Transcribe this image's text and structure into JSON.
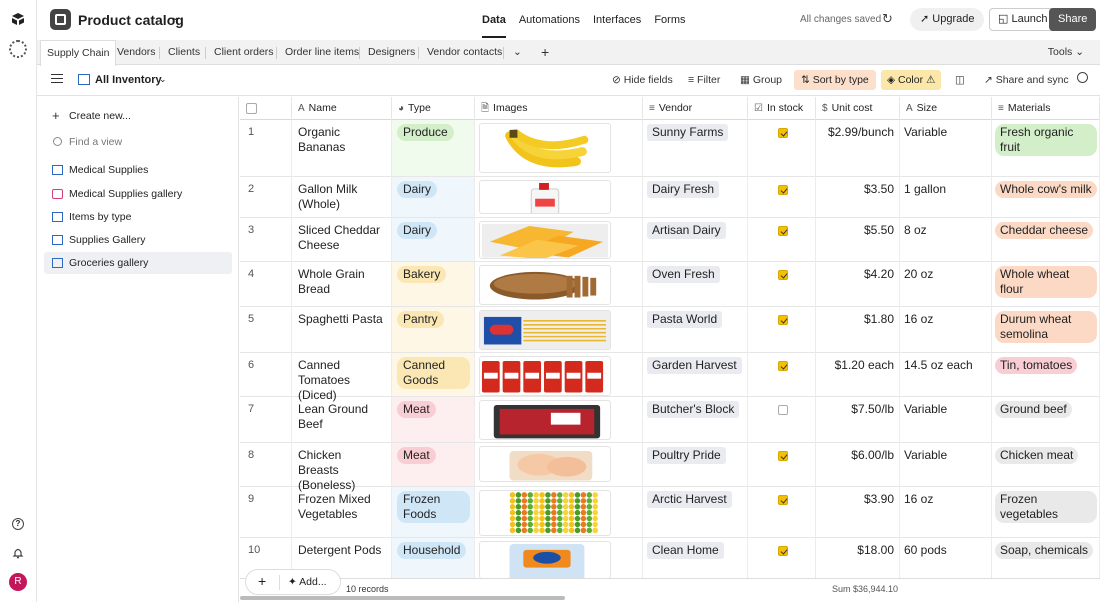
{
  "topbar": {
    "base_title": "Product catalog",
    "nav": [
      "Data",
      "Automations",
      "Interfaces",
      "Forms"
    ],
    "saved_status": "All changes saved",
    "upgrade_label": "Upgrade",
    "launch_label": "Launch",
    "share_label": "Share"
  },
  "tabs": {
    "items": [
      "Supply Chain",
      "Vendors",
      "Clients",
      "Client orders",
      "Order line items",
      "Designers",
      "Vendor contacts"
    ],
    "tools_label": "Tools"
  },
  "viewbar": {
    "view_name": "All Inventory",
    "hide_fields": "Hide fields",
    "filter": "Filter",
    "group": "Group",
    "sort": "Sort by type",
    "color": "Color",
    "share_sync": "Share and sync"
  },
  "sidebar": {
    "create_new": "Create new...",
    "find_view": "Find a view",
    "views": [
      {
        "label": "Medical Supplies",
        "icon": "grid-icon"
      },
      {
        "label": "Medical Supplies gallery",
        "icon": "gallery-icon"
      },
      {
        "label": "Items by type",
        "icon": "grid-icon"
      },
      {
        "label": "Supplies Gallery",
        "icon": "grid-icon"
      },
      {
        "label": "Groceries gallery",
        "icon": "grid-icon"
      }
    ]
  },
  "columns": [
    "Name",
    "Type",
    "Images",
    "Vendor",
    "In stock",
    "Unit cost",
    "Size",
    "Materials"
  ],
  "rows": [
    {
      "n": "1",
      "name": "Organic Bananas",
      "type": "Produce",
      "vendor": "Sunny Farms",
      "stock": true,
      "cost": "$2.99/bunch",
      "size": "Variable",
      "mat": "Fresh organic fruit"
    },
    {
      "n": "2",
      "name": "Gallon Milk (Whole)",
      "type": "Dairy",
      "vendor": "Dairy Fresh",
      "stock": true,
      "cost": "$3.50",
      "size": "1 gallon",
      "mat": "Whole cow's milk"
    },
    {
      "n": "3",
      "name": "Sliced Cheddar Cheese",
      "type": "Dairy",
      "vendor": "Artisan Dairy",
      "stock": true,
      "cost": "$5.50",
      "size": "8 oz",
      "mat": "Cheddar cheese"
    },
    {
      "n": "4",
      "name": "Whole Grain Bread",
      "type": "Bakery",
      "vendor": "Oven Fresh",
      "stock": true,
      "cost": "$4.20",
      "size": "20 oz",
      "mat": "Whole wheat flour"
    },
    {
      "n": "5",
      "name": "Spaghetti Pasta",
      "type": "Pantry",
      "vendor": "Pasta World",
      "stock": true,
      "cost": "$1.80",
      "size": "16 oz",
      "mat": "Durum wheat semolina"
    },
    {
      "n": "6",
      "name": "Canned Tomatoes (Diced)",
      "type": "Canned Goods",
      "vendor": "Garden Harvest",
      "stock": true,
      "cost": "$1.20 each",
      "size": "14.5 oz each",
      "mat": "Tin, tomatoes"
    },
    {
      "n": "7",
      "name": "Lean Ground Beef",
      "type": "Meat",
      "vendor": "Butcher's Block",
      "stock": false,
      "cost": "$7.50/lb",
      "size": "Variable",
      "mat": "Ground beef"
    },
    {
      "n": "8",
      "name": "Chicken Breasts (Boneless)",
      "type": "Meat",
      "vendor": "Poultry Pride",
      "stock": true,
      "cost": "$6.00/lb",
      "size": "Variable",
      "mat": "Chicken meat"
    },
    {
      "n": "9",
      "name": "Frozen Mixed Vegetables",
      "type": "Frozen Foods",
      "vendor": "Arctic Harvest",
      "stock": true,
      "cost": "$3.90",
      "size": "16 oz",
      "mat": "Frozen vegetables"
    },
    {
      "n": "10",
      "name": "Detergent Pods",
      "type": "Household",
      "vendor": "Clean Home",
      "stock": true,
      "cost": "$18.00",
      "size": "60 pods",
      "mat": "Soap, chemicals"
    }
  ],
  "footer": {
    "add_label": "Add...",
    "records": "10 records",
    "sum": "Sum $36,944.10"
  },
  "colors": {
    "produce": "#d3efc9",
    "dairy": "#cfe6f7",
    "bakery": "#fbe7b4",
    "meat": "#f8cdd3",
    "frozen": "#cfe6f7",
    "household": "#cfe6f7",
    "checkbox": "#f5c000"
  },
  "user_initial": "R"
}
